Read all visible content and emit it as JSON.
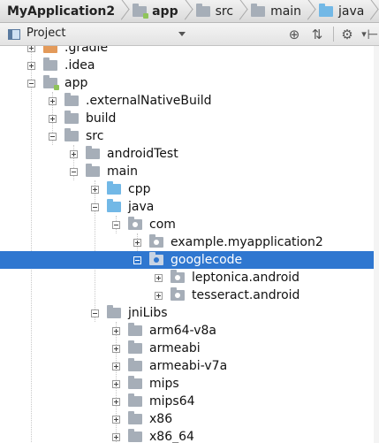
{
  "breadcrumb": [
    {
      "label": "MyApplication2",
      "icon": "none",
      "bold": true
    },
    {
      "label": "app",
      "icon": "app-module-folder-icon",
      "bold": true
    },
    {
      "label": "src",
      "icon": "folder-icon",
      "bold": false
    },
    {
      "label": "main",
      "icon": "folder-icon",
      "bold": false
    },
    {
      "label": "java",
      "icon": "source-folder-icon",
      "bold": false
    },
    {
      "label": "",
      "icon": "folder-icon",
      "bold": false
    }
  ],
  "toolbar": {
    "view_label": "Project",
    "icons": [
      "target-icon",
      "collapse-all-icon",
      "gear-icon",
      "hide-icon"
    ]
  },
  "tree": [
    {
      "label": ".gradle",
      "level": 1,
      "expanded": false,
      "icon": "orange",
      "partial": true
    },
    {
      "label": ".idea",
      "level": 1,
      "expanded": false,
      "icon": "plain"
    },
    {
      "label": "app",
      "level": 1,
      "expanded": true,
      "icon": "app"
    },
    {
      "label": ".externalNativeBuild",
      "level": 2,
      "expanded": false,
      "icon": "plain"
    },
    {
      "label": "build",
      "level": 2,
      "expanded": false,
      "icon": "plain"
    },
    {
      "label": "src",
      "level": 2,
      "expanded": true,
      "icon": "plain"
    },
    {
      "label": "androidTest",
      "level": 3,
      "expanded": false,
      "icon": "plain"
    },
    {
      "label": "main",
      "level": 3,
      "expanded": true,
      "icon": "plain"
    },
    {
      "label": "cpp",
      "level": 4,
      "expanded": false,
      "icon": "blue"
    },
    {
      "label": "java",
      "level": 4,
      "expanded": true,
      "icon": "blue"
    },
    {
      "label": "com",
      "level": 5,
      "expanded": true,
      "icon": "pkg"
    },
    {
      "label": "example.myapplication2",
      "level": 6,
      "expanded": false,
      "icon": "pkg"
    },
    {
      "label": "googlecode",
      "level": 6,
      "expanded": true,
      "icon": "pkg",
      "selected": true
    },
    {
      "label": "leptonica.android",
      "level": 7,
      "expanded": false,
      "icon": "pkg"
    },
    {
      "label": "tesseract.android",
      "level": 7,
      "expanded": false,
      "icon": "pkg"
    },
    {
      "label": "jniLibs",
      "level": 4,
      "expanded": true,
      "icon": "plain"
    },
    {
      "label": "arm64-v8a",
      "level": 5,
      "expanded": false,
      "icon": "plain"
    },
    {
      "label": "armeabi",
      "level": 5,
      "expanded": false,
      "icon": "plain"
    },
    {
      "label": "armeabi-v7a",
      "level": 5,
      "expanded": false,
      "icon": "plain"
    },
    {
      "label": "mips",
      "level": 5,
      "expanded": false,
      "icon": "plain"
    },
    {
      "label": "mips64",
      "level": 5,
      "expanded": false,
      "icon": "plain"
    },
    {
      "label": "x86",
      "level": 5,
      "expanded": false,
      "icon": "plain"
    },
    {
      "label": "x86_64",
      "level": 5,
      "expanded": false,
      "icon": "plain"
    }
  ],
  "colors": {
    "selection": "#2f77d0",
    "source_folder": "#72b8e6",
    "folder": "#a6aeb8"
  }
}
